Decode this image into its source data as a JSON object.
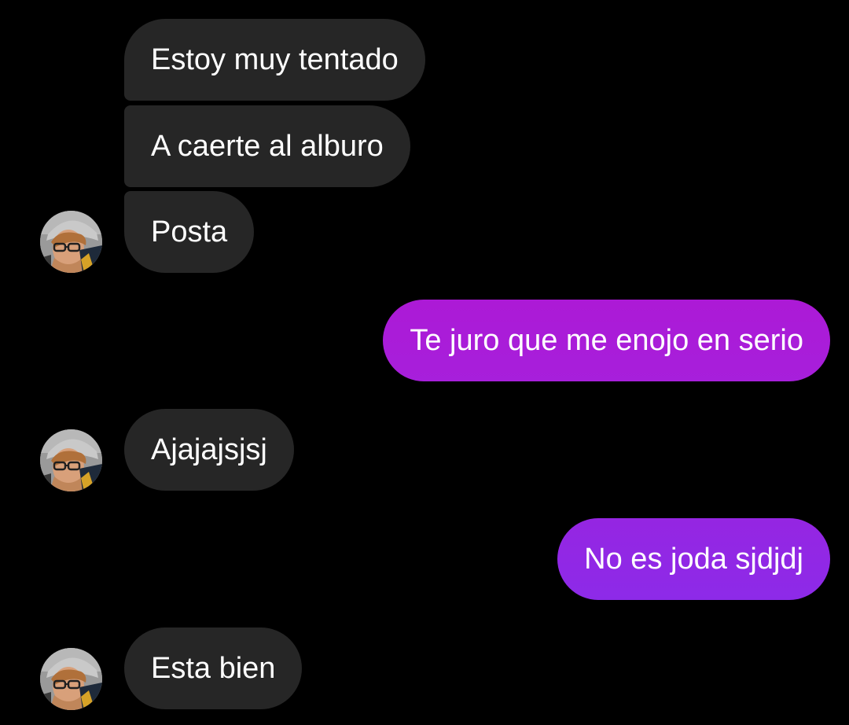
{
  "messages": [
    {
      "sender": "them",
      "text": "Estoy muy tentado"
    },
    {
      "sender": "them",
      "text": "A caerte al alburo"
    },
    {
      "sender": "them",
      "text": "Posta"
    },
    {
      "sender": "me",
      "text": "Te juro que me enojo en serio"
    },
    {
      "sender": "them",
      "text": "Ajajajsjsj"
    },
    {
      "sender": "me",
      "text": "No es joda sjdjdj"
    },
    {
      "sender": "them",
      "text": "Esta bien"
    }
  ],
  "colors": {
    "background": "#000000",
    "incoming_bubble": "#262626",
    "outgoing_gradient_top": "#a81fd8",
    "outgoing_gradient_bottom": "#8c2ae8",
    "text": "#ffffff"
  },
  "avatar": {
    "icon": "contact-avatar-photo"
  }
}
